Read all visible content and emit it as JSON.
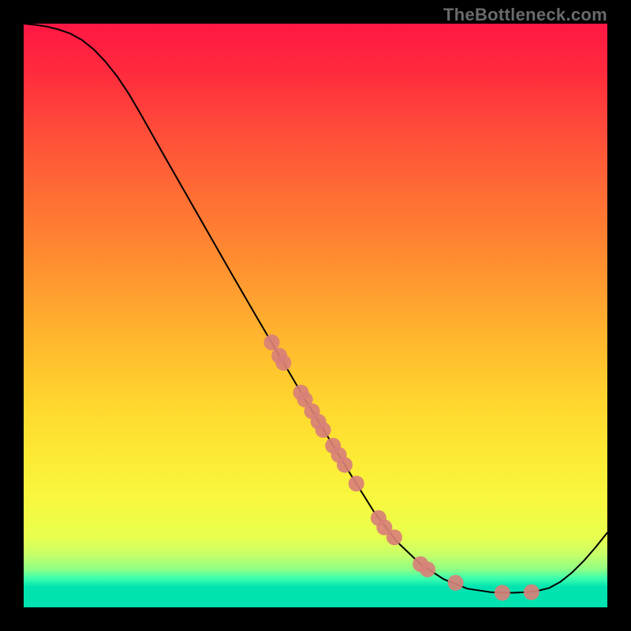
{
  "watermark": "TheBottleneck.com",
  "chart_data": {
    "type": "line",
    "title": "",
    "xlabel": "",
    "ylabel": "",
    "xlim": [
      0,
      100
    ],
    "ylim": [
      0,
      100
    ],
    "grid": false,
    "legend": false,
    "background": "rainbow-vertical",
    "series": [
      {
        "name": "curve",
        "stroke": "#000000",
        "stroke_width": 2,
        "x": [
          0,
          2,
          4,
          6,
          8,
          10,
          12,
          14,
          16,
          18,
          20,
          24,
          28,
          32,
          36,
          40,
          44,
          48,
          52,
          56,
          60,
          64,
          68,
          72,
          76,
          80,
          82,
          84,
          86,
          88,
          90,
          92,
          94,
          96,
          98,
          100
        ],
        "y": [
          100,
          99.8,
          99.5,
          99.0,
          98.3,
          97.2,
          95.6,
          93.5,
          91.0,
          88.0,
          84.6,
          77.5,
          70.5,
          63.5,
          56.5,
          49.6,
          42.8,
          36.0,
          29.4,
          22.8,
          16.4,
          11.2,
          7.4,
          4.8,
          3.2,
          2.6,
          2.5,
          2.5,
          2.6,
          2.8,
          3.3,
          4.4,
          6.0,
          8.0,
          10.3,
          12.8
        ]
      }
    ],
    "scatter": [
      {
        "name": "points-on-curve",
        "marker_color": "#d88078",
        "marker_radius": 10,
        "x": [
          42.5,
          43.8,
          44.5,
          47.5,
          48.2,
          49.4,
          50.5,
          51.3,
          53.0,
          54.0,
          55.0,
          57.0,
          60.8,
          61.8,
          63.5,
          68.0,
          69.2,
          74.0,
          82.0,
          87.0
        ],
        "y": [
          45.4,
          43.1,
          41.9,
          36.8,
          35.6,
          33.6,
          31.8,
          30.4,
          27.7,
          26.1,
          24.4,
          21.2,
          15.3,
          13.7,
          12.0,
          7.4,
          6.5,
          4.2,
          2.5,
          2.6
        ]
      }
    ]
  }
}
